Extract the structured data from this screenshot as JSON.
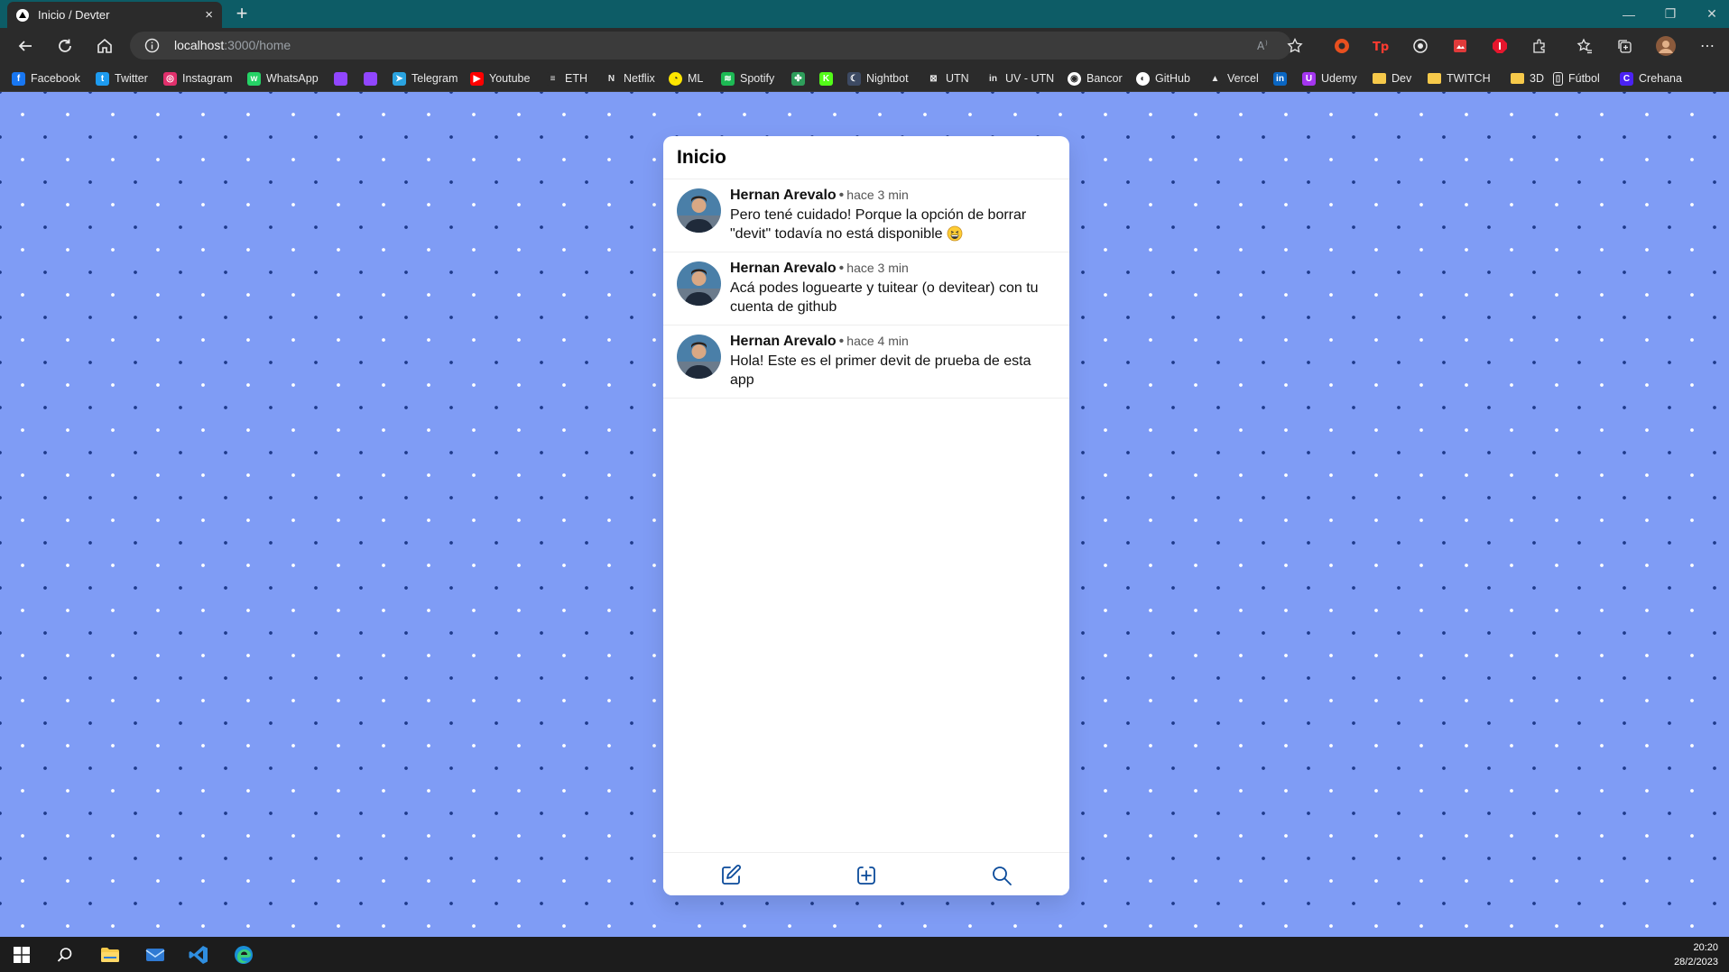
{
  "browser": {
    "tab_title": "Inicio / Devter",
    "tab_close": "×",
    "new_tab": "+",
    "url_host": "localhost",
    "url_path": ":3000/home",
    "window_controls": {
      "minimize": "—",
      "restore": "❐",
      "close": "✕"
    }
  },
  "bookmarks": [
    {
      "label": "Facebook",
      "icon": "facebook-icon",
      "color": "#1877f2",
      "glyph": "f"
    },
    {
      "label": "Twitter",
      "icon": "twitter-icon",
      "color": "#1d9bf0",
      "glyph": "t"
    },
    {
      "label": "Instagram",
      "icon": "instagram-icon",
      "color": "#e1306c",
      "glyph": "◎"
    },
    {
      "label": "WhatsApp",
      "icon": "whatsapp-icon",
      "color": "#25d366",
      "glyph": "w"
    },
    {
      "label": "",
      "icon": "twitch-icon",
      "color": "#9146ff",
      "glyph": ""
    },
    {
      "label": "",
      "icon": "twitch-icon",
      "color": "#9146ff",
      "glyph": ""
    },
    {
      "label": "Telegram",
      "icon": "telegram-icon",
      "color": "#2aa3e0",
      "glyph": "➤"
    },
    {
      "label": "Youtube",
      "icon": "youtube-icon",
      "color": "#ff0000",
      "glyph": "▶"
    },
    {
      "label": "ETH",
      "icon": "eth-icon",
      "color": "#2b2b2b",
      "glyph": "≡"
    },
    {
      "label": "Netflix",
      "icon": "netflix-icon",
      "color": "#2b2b2b",
      "glyph": "N"
    },
    {
      "label": "ML",
      "icon": "mercadolibre-icon",
      "color": "#ffe600",
      "glyph": "◔"
    },
    {
      "label": "Spotify",
      "icon": "spotify-icon",
      "color": "#1db954",
      "glyph": "≋"
    },
    {
      "label": "",
      "icon": "clover-icon",
      "color": "#2e9e5b",
      "glyph": "✤"
    },
    {
      "label": "",
      "icon": "kick-icon",
      "color": "#53fc18",
      "glyph": "K"
    },
    {
      "label": "Nightbot",
      "icon": "nightbot-icon",
      "color": "#3d4a63",
      "glyph": "☾"
    },
    {
      "label": "UTN",
      "icon": "utn-icon",
      "color": "#2b2b2b",
      "glyph": "⊠"
    },
    {
      "label": "UV - UTN",
      "icon": "uv-utn-icon",
      "color": "#2b2b2b",
      "glyph": "in"
    },
    {
      "label": "Bancor",
      "icon": "bancor-icon",
      "color": "#ffffff",
      "glyph": "◉"
    },
    {
      "label": "GitHub",
      "icon": "github-icon",
      "color": "#ffffff",
      "glyph": "◐"
    },
    {
      "label": "Vercel",
      "icon": "vercel-icon",
      "color": "#2b2b2b",
      "glyph": "▲"
    },
    {
      "label": "",
      "icon": "linkedin-icon",
      "color": "#0a66c2",
      "glyph": "in"
    },
    {
      "label": "Udemy",
      "icon": "udemy-icon",
      "color": "#a435f0",
      "glyph": "U"
    },
    {
      "label": "Dev",
      "icon": "folder-icon",
      "color": "#f6c94a",
      "glyph": ""
    },
    {
      "label": "TWITCH",
      "icon": "folder-icon",
      "color": "#f6c94a",
      "glyph": ""
    },
    {
      "label": "3D",
      "icon": "folder-icon",
      "color": "#f6c94a",
      "glyph": ""
    },
    {
      "label": "Fútbol",
      "icon": "page-icon",
      "color": "#2b2b2b",
      "glyph": "▯"
    },
    {
      "label": "Crehana",
      "icon": "crehana-icon",
      "color": "#4b22f4",
      "glyph": "C"
    }
  ],
  "app": {
    "title": "Inicio",
    "devits": [
      {
        "author": "Hernan Arevalo",
        "separator": "•",
        "time": "hace 3 min",
        "content": "Pero tené cuidado! Porque la opción de borrar \"devit\" todavía no está disponible"
      },
      {
        "author": "Hernan Arevalo",
        "separator": "•",
        "time": "hace 3 min",
        "content": "Acá podes loguearte y tuitear (o devitear) con tu cuenta de github"
      },
      {
        "author": "Hernan Arevalo",
        "separator": "•",
        "time": "hace 4 min",
        "content": "Hola! Este es el primer devit de prueba de esta app"
      }
    ],
    "nav": [
      "create-icon",
      "add-icon",
      "search-icon"
    ]
  },
  "taskbar": {
    "time": "20:20",
    "date": "28/2/2023"
  },
  "colors": {
    "page_bg": "#7f9cf5",
    "accent": "#0a4a9a",
    "tabbar": "#0d5c66"
  }
}
